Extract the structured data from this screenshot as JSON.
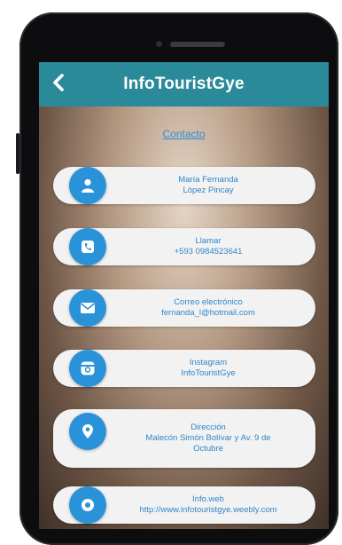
{
  "header": {
    "title": "InfoTouristGye",
    "back_icon": "chevron-left-icon"
  },
  "section": {
    "title": "Contacto"
  },
  "contacts": [
    {
      "icon": "user-icon",
      "line1": "María Fernanda",
      "line2": "López Pincay",
      "line3": ""
    },
    {
      "icon": "phone-icon",
      "line1": "Llamar",
      "line2": "+593 0984523641",
      "line3": ""
    },
    {
      "icon": "mail-icon",
      "line1": "Correo electrónico",
      "line2": "fernanda_l@hotmail.com",
      "line3": ""
    },
    {
      "icon": "instagram-icon",
      "line1": "Instagram",
      "line2": "InfoTouristGye",
      "line3": ""
    },
    {
      "icon": "location-icon",
      "line1": "Dirección",
      "line2": "Malecón Simón Bolívar y Av. 9 de",
      "line3": "Octubre"
    },
    {
      "icon": "web-icon",
      "line1": "Info.web",
      "line2": "http://www.infotouristgye.weebly.com",
      "line3": ""
    }
  ],
  "colors": {
    "accent": "#2a8a99",
    "icon_circle": "#2a92d8",
    "link_text": "#2f86c9"
  }
}
